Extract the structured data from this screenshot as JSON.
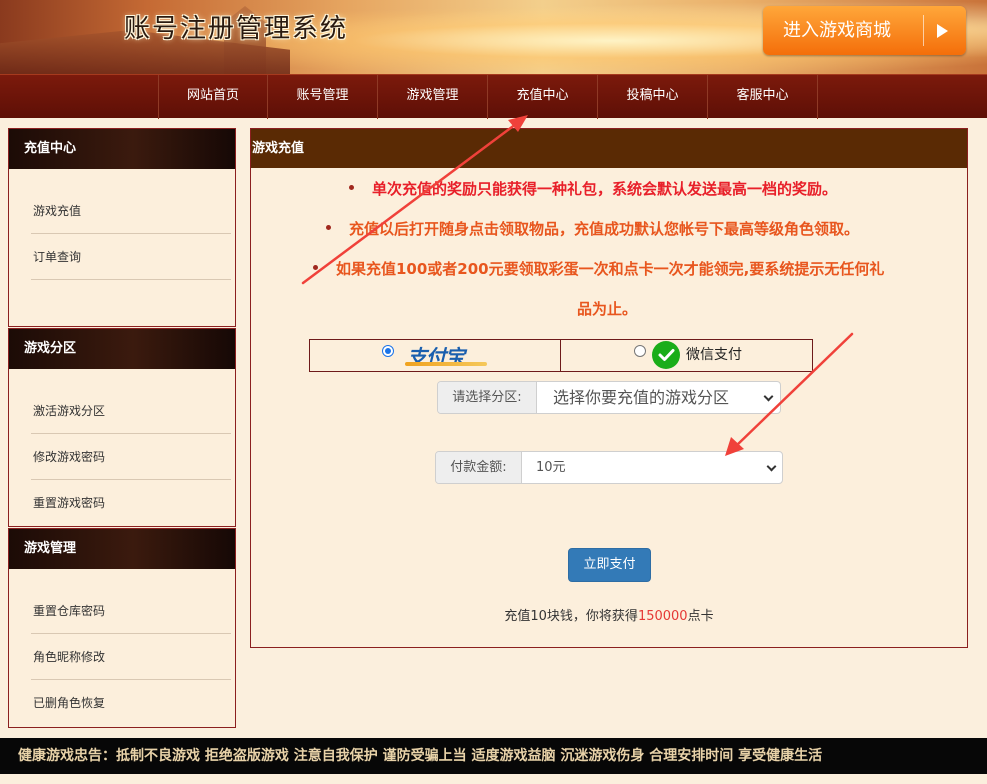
{
  "header": {
    "title": "账号注册管理系统",
    "shop_button": "进入游戏商城"
  },
  "nav": {
    "items": [
      "网站首页",
      "账号管理",
      "游戏管理",
      "充值中心",
      "投稿中心",
      "客服中心"
    ]
  },
  "sidebar": {
    "sections": [
      {
        "title": "充值中心",
        "items": [
          "游戏充值",
          "订单查询"
        ]
      },
      {
        "title": "游戏分区",
        "items": [
          "激活游戏分区",
          "修改游戏密码",
          "重置游戏密码"
        ]
      },
      {
        "title": "游戏管理",
        "items": [
          "重置仓库密码",
          "角色昵称修改",
          "已删角色恢复"
        ]
      }
    ]
  },
  "main": {
    "title": "游戏充值",
    "notices": [
      "单次充值的奖励只能获得一种礼包，系统会默认发送最高一档的奖励。",
      "充值以后打开随身点击领取物品，充值成功默认您帐号下最高等级角色领取。",
      "如果充值100或者200元要领取彩蛋一次和点卡一次才能领完,要系统提示无任何礼",
      "品为止。"
    ],
    "notice_colors": [
      "#e8202a",
      "#e8561e",
      "#e8561e"
    ],
    "payment": {
      "alipay_label": "支付宝",
      "alipay_selected": true,
      "wechat_label": "微信支付",
      "wechat_selected": false
    },
    "zone_field": {
      "label": "请选择分区:",
      "value": "选择你要充值的游戏分区"
    },
    "amount_field": {
      "label": "付款金额:",
      "value": "10元"
    },
    "submit_label": "立即支付",
    "summary": {
      "prefix": "充值10块钱，你将获得",
      "points": "150000",
      "suffix": "点卡"
    }
  },
  "footer": {
    "text": "健康游戏忠告：抵制不良游戏 拒绝盗版游戏 注意自我保护 谨防受骗上当 适度游戏益脑 沉迷游戏伤身 合理安排时间 享受健康生活"
  }
}
